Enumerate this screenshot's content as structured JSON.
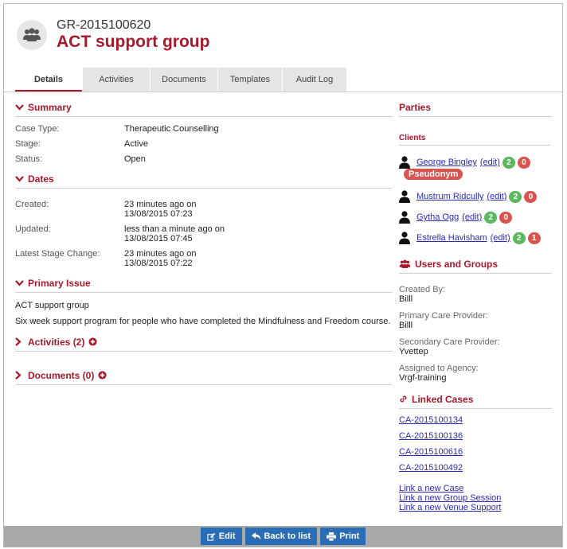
{
  "header": {
    "case_ref": "GR-2015100620",
    "title": "ACT support group"
  },
  "tabs": [
    {
      "label": "Details"
    },
    {
      "label": "Activities"
    },
    {
      "label": "Documents"
    },
    {
      "label": "Templates"
    },
    {
      "label": "Audit Log"
    }
  ],
  "summary": {
    "heading": "Summary",
    "rows": [
      {
        "label": "Case Type:",
        "value": "Therapeutic Counselling"
      },
      {
        "label": "Stage:",
        "value": "Active"
      },
      {
        "label": "Status:",
        "value": "Open"
      }
    ]
  },
  "dates": {
    "heading": "Dates",
    "rows": [
      {
        "label": "Created:",
        "line1": "23 minutes ago on",
        "line2": "13/08/2015 07:23"
      },
      {
        "label": "Updated:",
        "line1": "less than a minute ago on",
        "line2": "13/08/2015 07:45"
      },
      {
        "label": "Latest Stage Change:",
        "line1": "23 minutes ago on",
        "line2": "13/08/2015 07:22"
      }
    ]
  },
  "primary_issue": {
    "heading": "Primary Issue",
    "title": "ACT support group",
    "description": "Six week support program for people who have completed the Mindfulness and Freedom course."
  },
  "activities": {
    "heading": "Activities (2)"
  },
  "documents": {
    "heading": "Documents (0)"
  },
  "parties": {
    "heading": "Parties",
    "clients_heading": "Clients",
    "edit_label": "(edit)",
    "pseudonym_label": "Pseudonym",
    "clients": [
      {
        "name": "George Bingley",
        "green": "2",
        "red": "0"
      },
      {
        "name": "Mustrum Ridcully",
        "green": "2",
        "red": "0"
      },
      {
        "name": "Gytha Ogg",
        "green": "2",
        "red": "0"
      },
      {
        "name": "Estrella Havisham",
        "green": "2",
        "red": "1"
      }
    ]
  },
  "users_groups": {
    "heading": "Users and Groups",
    "items": [
      {
        "label": "Created By:",
        "value": "Billl"
      },
      {
        "label": "Primary Care Provider:",
        "value": "Billl"
      },
      {
        "label": "Secondary Care Provider:",
        "value": "Yvettep"
      },
      {
        "label": "Assigned to Agency:",
        "value": "Vrgf-training"
      }
    ]
  },
  "linked_cases": {
    "heading": "Linked Cases",
    "cases": [
      "CA-2015100134",
      "CA-2015100136",
      "CA-2015100616",
      "CA-2015100492"
    ],
    "actions": [
      "Link a new Case",
      "Link a new Group Session",
      "Link a new Venue Support"
    ]
  },
  "footer": {
    "edit": "Edit",
    "back": "Back to list",
    "print": "Print"
  },
  "colors": {
    "brand": "#a7192d",
    "button": "#2a6db5",
    "badge_green": "#5cb85c",
    "badge_red": "#d9534f"
  }
}
